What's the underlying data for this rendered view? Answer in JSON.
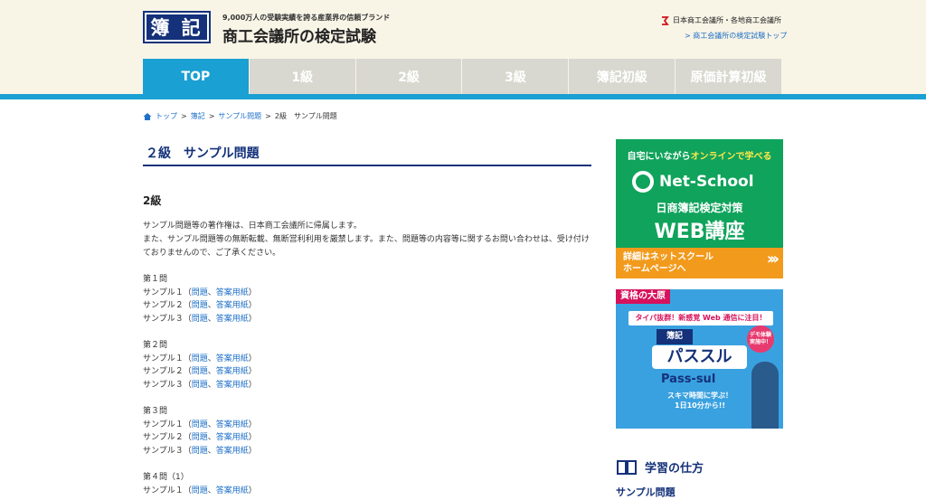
{
  "header": {
    "logo": "簿 記",
    "tagline": "9,000万人の受験実績を誇る産業界の信頼ブランド",
    "title": "商工会議所の検定試験",
    "org": "日本商工会議所・各地商工会議所",
    "top_link": "> 商工会議所の検定試験トップ"
  },
  "nav": [
    "TOP",
    "1級",
    "2級",
    "3級",
    "簿記初級",
    "原価計算初級"
  ],
  "breadcrumb": {
    "home": "トップ",
    "sep": ">",
    "items": [
      "簿記",
      "サンプル問題"
    ],
    "current": "2級　サンプル問題"
  },
  "main": {
    "page_title": "２級　サンプル問題",
    "section_title": "2級",
    "desc1": "サンプル問題等の著作権は、日本商工会議所に帰属します。",
    "desc2": "また、サンプル問題等の無断転載、無断営利利用を厳禁します。また、問題等の内容等に関するお問い合わせは、受け付けておりませんので、ご了承ください。",
    "questions": [
      {
        "heading": "第１問",
        "samples": [
          "サンプル１",
          "サンプル２",
          "サンプル３"
        ]
      },
      {
        "heading": "第２問",
        "samples": [
          "サンプル１",
          "サンプル２",
          "サンプル３"
        ]
      },
      {
        "heading": "第３問",
        "samples": [
          "サンプル１",
          "サンプル２",
          "サンプル３"
        ]
      },
      {
        "heading": "第４問（1）",
        "samples": [
          "サンプル１"
        ]
      }
    ],
    "open_paren": "（",
    "link_q": "問題",
    "comma": "、",
    "link_a": "答案用紙",
    "close_paren": "）"
  },
  "ads": {
    "netschool": {
      "top_a": "自宅にいながら",
      "top_b": "オンラインで学べる",
      "brand": "Net-School",
      "line": "日商簿記検定対策",
      "web": "WEB講座",
      "bottom_1": "詳細はネットスクール",
      "bottom_2": "ホームページへ",
      "arrows": "›››"
    },
    "ohara": {
      "tag": "資格の大原",
      "banner": "タイパ抜群！新感覚 Web 通信に注目！",
      "boki": "簿記",
      "demo": "デモ体験 実施中！",
      "name": "パススル",
      "en": "Pass-sul",
      "sub1": "スキマ時間に学ぶ！",
      "sub2": "1日10分から!!"
    }
  },
  "sidebar": {
    "heading": "学習の仕方",
    "link": "サンプル問題"
  },
  "colors": {
    "brand_navy": "#14317a",
    "accent_blue": "#1aa0d2",
    "link": "#1e70c8",
    "header_bg": "#f8f4e6"
  }
}
